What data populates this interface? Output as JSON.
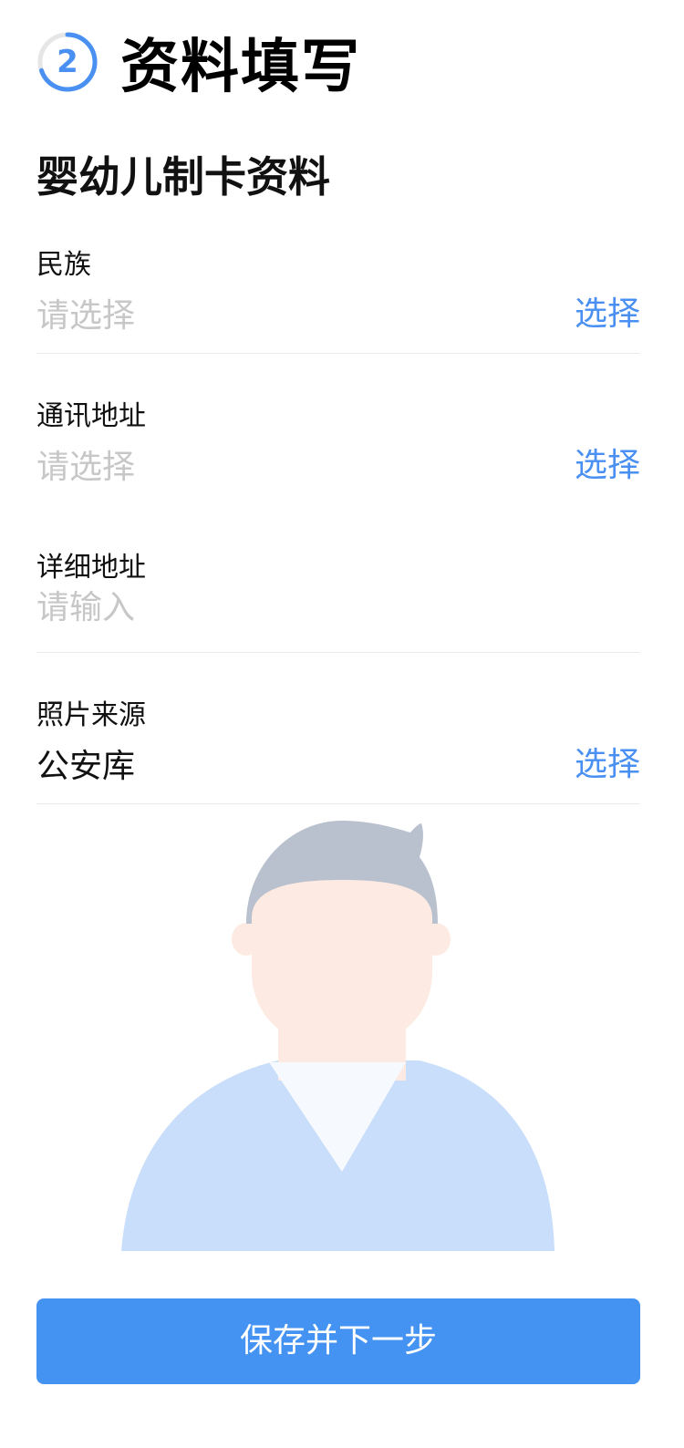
{
  "header": {
    "step_number": "2",
    "title": "资料填写"
  },
  "section": {
    "title": "婴幼儿制卡资料"
  },
  "fields": [
    {
      "label": "民族",
      "value": "请选择",
      "action": "选择",
      "filled": false
    },
    {
      "label": "通讯地址",
      "value": "请选择",
      "action": "选择",
      "filled": false
    },
    {
      "label": "详细地址",
      "placeholder": "请输入"
    },
    {
      "label": "照片来源",
      "value": "公安库",
      "action": "选择",
      "filled": true
    }
  ],
  "avatar": {
    "icon": "person-avatar-placeholder"
  },
  "colors": {
    "accent": "#4a90f2",
    "button": "#4492f2",
    "placeholder": "#c7c7c7",
    "divider": "#ebebeb"
  },
  "footer": {
    "save_label": "保存并下一步"
  }
}
